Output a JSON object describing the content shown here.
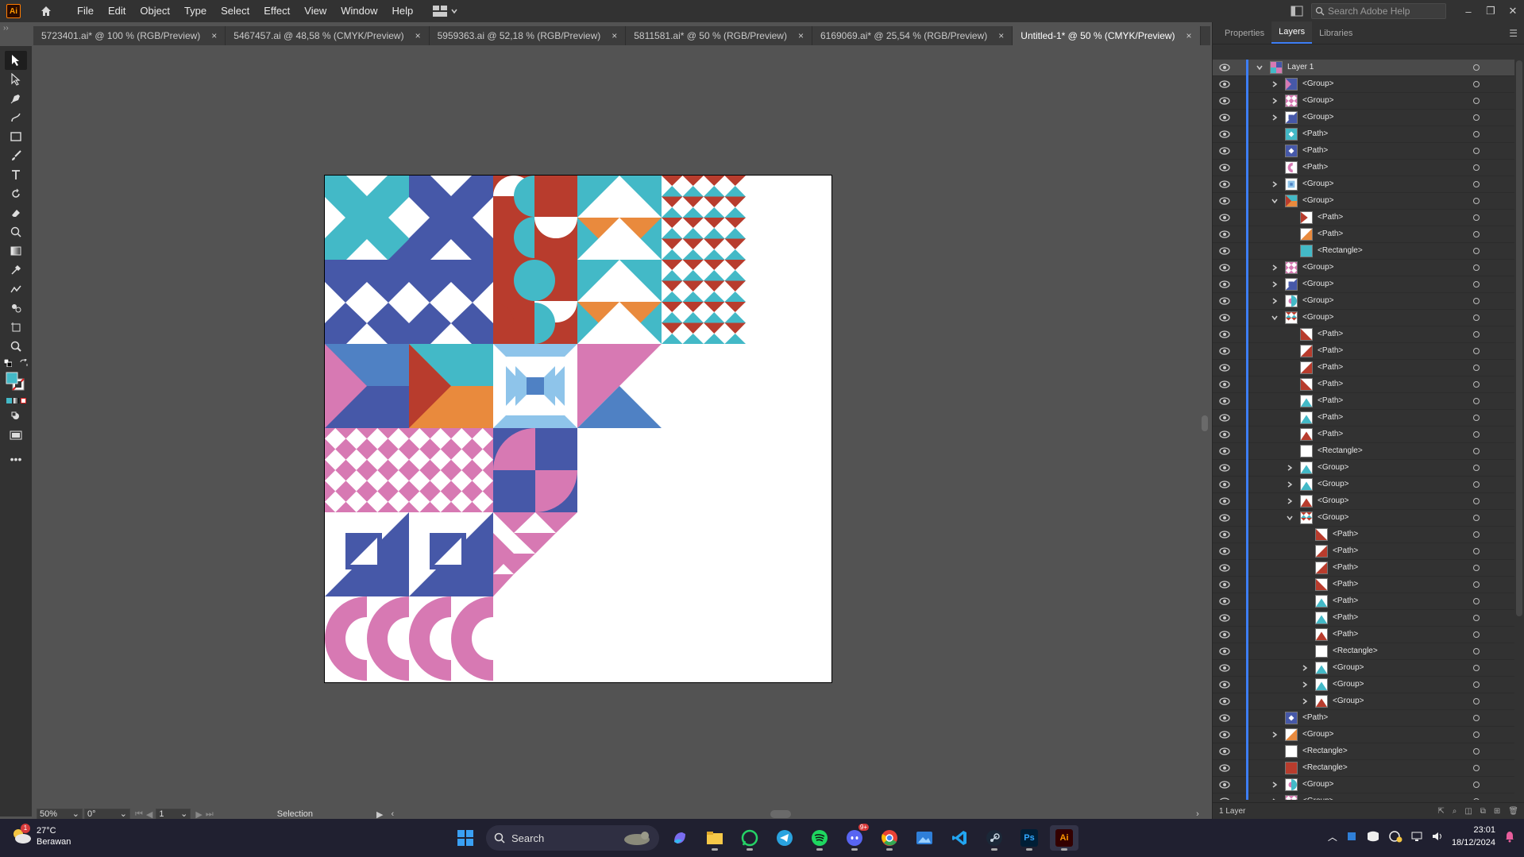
{
  "app": {
    "logo": "Ai",
    "title": "Adobe Illustrator"
  },
  "menu": [
    "File",
    "Edit",
    "Object",
    "Type",
    "Select",
    "Effect",
    "View",
    "Window",
    "Help"
  ],
  "search_help": {
    "placeholder": "Search Adobe Help"
  },
  "tabs": [
    {
      "label": "5723401.ai* @ 100 % (RGB/Preview)",
      "active": false
    },
    {
      "label": "5467457.ai @ 48,58 % (CMYK/Preview)",
      "active": false
    },
    {
      "label": "5959363.ai @ 52,18 % (RGB/Preview)",
      "active": false
    },
    {
      "label": "5811581.ai* @ 50 % (RGB/Preview)",
      "active": false
    },
    {
      "label": "6169069.ai* @ 25,54 % (RGB/Preview)",
      "active": false
    },
    {
      "label": "Untitled-1* @ 50 % (CMYK/Preview)",
      "active": true
    }
  ],
  "tab_close": "×",
  "status": {
    "zoom": "50%",
    "rotation": "0°",
    "artboard": "1",
    "tool": "Selection"
  },
  "panel": {
    "tabs": [
      "Properties",
      "Layers",
      "Libraries"
    ],
    "active_tab": "Layers",
    "footer_text": "1 Layer",
    "layers": [
      {
        "name": "Layer 1",
        "depth": 0,
        "arrow": "open",
        "thumb": "layer"
      },
      {
        "name": "<Group>",
        "depth": 1,
        "arrow": "closed",
        "thumb": "blue-pink"
      },
      {
        "name": "<Group>",
        "depth": 1,
        "arrow": "closed",
        "thumb": "pink-check"
      },
      {
        "name": "<Group>",
        "depth": 1,
        "arrow": "closed",
        "thumb": "blue-square"
      },
      {
        "name": "<Path>",
        "depth": 1,
        "arrow": "none",
        "thumb": "teal-x"
      },
      {
        "name": "<Path>",
        "depth": 1,
        "arrow": "none",
        "thumb": "blue-x"
      },
      {
        "name": "<Path>",
        "depth": 1,
        "arrow": "none",
        "thumb": "pink-c"
      },
      {
        "name": "<Group>",
        "depth": 1,
        "arrow": "closed",
        "thumb": "blue-frame"
      },
      {
        "name": "<Group>",
        "depth": 1,
        "arrow": "open",
        "thumb": "orange-red"
      },
      {
        "name": "<Path>",
        "depth": 2,
        "arrow": "none",
        "thumb": "red-tri"
      },
      {
        "name": "<Path>",
        "depth": 2,
        "arrow": "none",
        "thumb": "orange-tri"
      },
      {
        "name": "<Rectangle>",
        "depth": 2,
        "arrow": "none",
        "thumb": "teal-rect"
      },
      {
        "name": "<Group>",
        "depth": 1,
        "arrow": "closed",
        "thumb": "pink-check"
      },
      {
        "name": "<Group>",
        "depth": 1,
        "arrow": "closed",
        "thumb": "blue-square"
      },
      {
        "name": "<Group>",
        "depth": 1,
        "arrow": "closed",
        "thumb": "teal-pink"
      },
      {
        "name": "<Group>",
        "depth": 1,
        "arrow": "open",
        "thumb": "red-check"
      },
      {
        "name": "<Path>",
        "depth": 2,
        "arrow": "none",
        "thumb": "red-diag"
      },
      {
        "name": "<Path>",
        "depth": 2,
        "arrow": "none",
        "thumb": "red-diag2"
      },
      {
        "name": "<Path>",
        "depth": 2,
        "arrow": "none",
        "thumb": "red-diag2"
      },
      {
        "name": "<Path>",
        "depth": 2,
        "arrow": "none",
        "thumb": "red-diag"
      },
      {
        "name": "<Path>",
        "depth": 2,
        "arrow": "none",
        "thumb": "teal-tri"
      },
      {
        "name": "<Path>",
        "depth": 2,
        "arrow": "none",
        "thumb": "teal-tri"
      },
      {
        "name": "<Path>",
        "depth": 2,
        "arrow": "none",
        "thumb": "red-tri-up"
      },
      {
        "name": "<Rectangle>",
        "depth": 2,
        "arrow": "none",
        "thumb": "white-rect"
      },
      {
        "name": "<Group>",
        "depth": 2,
        "arrow": "closed",
        "thumb": "teal-tri"
      },
      {
        "name": "<Group>",
        "depth": 2,
        "arrow": "closed",
        "thumb": "teal-tri"
      },
      {
        "name": "<Group>",
        "depth": 2,
        "arrow": "closed",
        "thumb": "red-tri-up"
      },
      {
        "name": "<Group>",
        "depth": 2,
        "arrow": "open",
        "thumb": "red-check"
      },
      {
        "name": "<Path>",
        "depth": 3,
        "arrow": "none",
        "thumb": "red-diag"
      },
      {
        "name": "<Path>",
        "depth": 3,
        "arrow": "none",
        "thumb": "red-diag2"
      },
      {
        "name": "<Path>",
        "depth": 3,
        "arrow": "none",
        "thumb": "red-diag2"
      },
      {
        "name": "<Path>",
        "depth": 3,
        "arrow": "none",
        "thumb": "red-diag"
      },
      {
        "name": "<Path>",
        "depth": 3,
        "arrow": "none",
        "thumb": "teal-tri"
      },
      {
        "name": "<Path>",
        "depth": 3,
        "arrow": "none",
        "thumb": "teal-tri"
      },
      {
        "name": "<Path>",
        "depth": 3,
        "arrow": "none",
        "thumb": "red-tri-up"
      },
      {
        "name": "<Rectangle>",
        "depth": 3,
        "arrow": "none",
        "thumb": "white-rect"
      },
      {
        "name": "<Group>",
        "depth": 3,
        "arrow": "closed",
        "thumb": "teal-tri"
      },
      {
        "name": "<Group>",
        "depth": 3,
        "arrow": "closed",
        "thumb": "teal-tri"
      },
      {
        "name": "<Group>",
        "depth": 3,
        "arrow": "closed",
        "thumb": "red-tri-up"
      },
      {
        "name": "<Path>",
        "depth": 1,
        "arrow": "none",
        "thumb": "blue-x"
      },
      {
        "name": "<Group>",
        "depth": 1,
        "arrow": "closed",
        "thumb": "orange-tri"
      },
      {
        "name": "<Rectangle>",
        "depth": 1,
        "arrow": "none",
        "thumb": "white-rect"
      },
      {
        "name": "<Rectangle>",
        "depth": 1,
        "arrow": "none",
        "thumb": "red-rect"
      },
      {
        "name": "<Group>",
        "depth": 1,
        "arrow": "closed",
        "thumb": "teal-pink"
      },
      {
        "name": "<Group>",
        "depth": 1,
        "arrow": "closed",
        "thumb": "pink-check"
      }
    ]
  },
  "taskbar": {
    "weather_temp": "27°C",
    "weather_desc": "Berawan",
    "weather_badge": "1",
    "search_label": "Search",
    "discord_badge": "9+",
    "time": "23:01",
    "date": "18/12/2024",
    "apps": [
      "windows-start",
      "copilot",
      "file-explorer",
      "whatsapp",
      "telegram",
      "spotify",
      "discord",
      "chrome",
      "photos",
      "vscode",
      "steam",
      "photoshop",
      "illustrator"
    ]
  },
  "colors": {
    "teal": "#43b9c7",
    "blue": "#4658a8",
    "red": "#b83c2d",
    "orange": "#e98a3d",
    "pink": "#d779b3",
    "light_blue": "#8ec4ea",
    "mid_blue": "#4f81c4",
    "accent": "#3d7ef6"
  }
}
